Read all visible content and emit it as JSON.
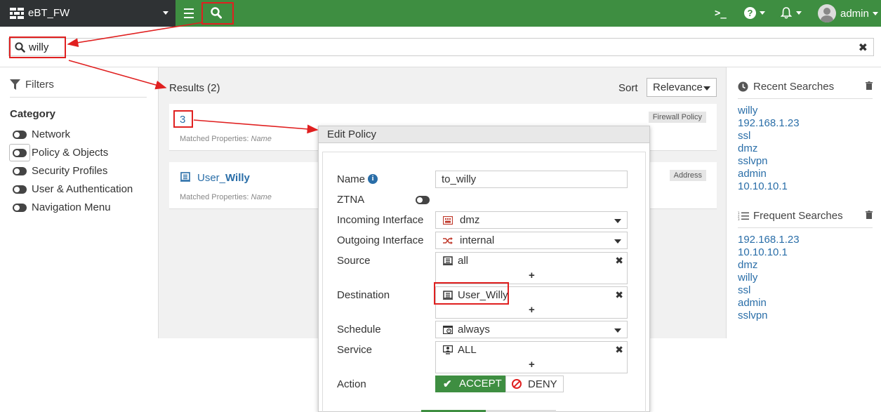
{
  "topbar": {
    "device_name": "eBT_FW",
    "cli_label": ">_",
    "help_label": "?",
    "user": "admin"
  },
  "search": {
    "value": "willy",
    "clear_label": "✖"
  },
  "filters": {
    "title": "Filters",
    "category_title": "Category",
    "items": [
      "Network",
      "Policy & Objects",
      "Security Profiles",
      "User & Authentication",
      "Navigation Menu"
    ]
  },
  "results": {
    "title": "Results (2)",
    "sort_label": "Sort",
    "sort_value": "Relevance",
    "cards": [
      {
        "title": "3",
        "matched_label": "Matched Properties:",
        "matched_value": "Name",
        "badge": "Firewall Policy"
      },
      {
        "title": "User_Willy",
        "title_prefix": "User_",
        "title_bold": "Willy",
        "matched_label": "Matched Properties:",
        "matched_value": "Name",
        "badge": "Address"
      }
    ]
  },
  "edit_policy": {
    "title": "Edit Policy",
    "fields": {
      "name_label": "Name",
      "name_value": "to_willy",
      "ztna_label": "ZTNA",
      "incoming_label": "Incoming Interface",
      "incoming_value": "dmz",
      "outgoing_label": "Outgoing Interface",
      "outgoing_value": "internal",
      "source_label": "Source",
      "source_value": "all",
      "destination_label": "Destination",
      "destination_value": "User_Willy",
      "schedule_label": "Schedule",
      "schedule_value": "always",
      "service_label": "Service",
      "service_value": "ALL",
      "action_label": "Action",
      "accept_label": "ACCEPT",
      "deny_label": "DENY",
      "plus_label": "+",
      "remove_label": "✖",
      "info_label": "i"
    }
  },
  "recent": {
    "title": "Recent Searches",
    "items": [
      "willy",
      "192.168.1.23",
      "ssl",
      "dmz",
      "sslvpn",
      "admin",
      "10.10.10.1"
    ]
  },
  "frequent": {
    "title": "Frequent Searches",
    "items": [
      "192.168.1.23",
      "10.10.10.1",
      "dmz",
      "willy",
      "ssl",
      "admin",
      "sslvpn"
    ]
  },
  "colors": {
    "topbar": "#3e8e41",
    "brand_bg": "#2f3234",
    "link": "#2a6ea8",
    "highlight": "#e02020"
  }
}
